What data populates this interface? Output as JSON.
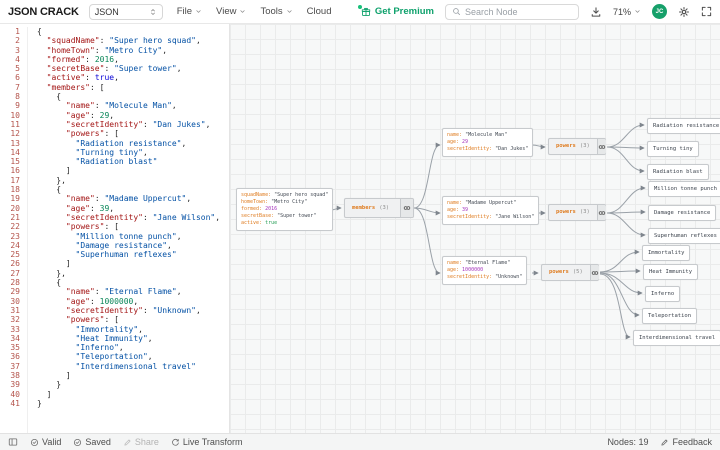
{
  "toolbar": {
    "logo": "JSON CRACK",
    "format_select": "JSON",
    "menu_file": "File",
    "menu_view": "View",
    "menu_tools": "Tools",
    "menu_cloud": "Cloud",
    "get_premium": "Get Premium",
    "search_placeholder": "Search Node",
    "zoom_level": "71%",
    "avatar_initials": "JC"
  },
  "colors": {
    "accent_green": "#0ea16c",
    "node_key_orange": "#df7c20",
    "node_number_purple": "#a534bd",
    "node_bool_green": "#2ba05a",
    "editor_key_red": "#a31515",
    "editor_string_blue": "#0451a5",
    "editor_number_green": "#098658"
  },
  "editor": {
    "lines": [
      [
        [
          "p",
          "{"
        ]
      ],
      [
        [
          "p",
          "  "
        ],
        [
          "k",
          "\"squadName\""
        ],
        [
          "p",
          ": "
        ],
        [
          "s",
          "\"Super hero squad\""
        ],
        [
          "p",
          ","
        ]
      ],
      [
        [
          "p",
          "  "
        ],
        [
          "k",
          "\"homeTown\""
        ],
        [
          "p",
          ": "
        ],
        [
          "s",
          "\"Metro City\""
        ],
        [
          "p",
          ","
        ]
      ],
      [
        [
          "p",
          "  "
        ],
        [
          "k",
          "\"formed\""
        ],
        [
          "p",
          ": "
        ],
        [
          "n",
          "2016"
        ],
        [
          "p",
          ","
        ]
      ],
      [
        [
          "p",
          "  "
        ],
        [
          "k",
          "\"secretBase\""
        ],
        [
          "p",
          ": "
        ],
        [
          "s",
          "\"Super tower\""
        ],
        [
          "p",
          ","
        ]
      ],
      [
        [
          "p",
          "  "
        ],
        [
          "k",
          "\"active\""
        ],
        [
          "p",
          ": "
        ],
        [
          "b",
          "true"
        ],
        [
          "p",
          ","
        ]
      ],
      [
        [
          "p",
          "  "
        ],
        [
          "k",
          "\"members\""
        ],
        [
          "p",
          ": ["
        ]
      ],
      [
        [
          "p",
          "    {"
        ]
      ],
      [
        [
          "p",
          "      "
        ],
        [
          "k",
          "\"name\""
        ],
        [
          "p",
          ": "
        ],
        [
          "s",
          "\"Molecule Man\""
        ],
        [
          "p",
          ","
        ]
      ],
      [
        [
          "p",
          "      "
        ],
        [
          "k",
          "\"age\""
        ],
        [
          "p",
          ": "
        ],
        [
          "n",
          "29"
        ],
        [
          "p",
          ","
        ]
      ],
      [
        [
          "p",
          "      "
        ],
        [
          "k",
          "\"secretIdentity\""
        ],
        [
          "p",
          ": "
        ],
        [
          "s",
          "\"Dan Jukes\""
        ],
        [
          "p",
          ","
        ]
      ],
      [
        [
          "p",
          "      "
        ],
        [
          "k",
          "\"powers\""
        ],
        [
          "p",
          ": ["
        ]
      ],
      [
        [
          "p",
          "        "
        ],
        [
          "s",
          "\"Radiation resistance\""
        ],
        [
          "p",
          ","
        ]
      ],
      [
        [
          "p",
          "        "
        ],
        [
          "s",
          "\"Turning tiny\""
        ],
        [
          "p",
          ","
        ]
      ],
      [
        [
          "p",
          "        "
        ],
        [
          "s",
          "\"Radiation blast\""
        ]
      ],
      [
        [
          "p",
          "      ]"
        ]
      ],
      [
        [
          "p",
          "    },"
        ]
      ],
      [
        [
          "p",
          "    {"
        ]
      ],
      [
        [
          "p",
          "      "
        ],
        [
          "k",
          "\"name\""
        ],
        [
          "p",
          ": "
        ],
        [
          "s",
          "\"Madame Uppercut\""
        ],
        [
          "p",
          ","
        ]
      ],
      [
        [
          "p",
          "      "
        ],
        [
          "k",
          "\"age\""
        ],
        [
          "p",
          ": "
        ],
        [
          "n",
          "39"
        ],
        [
          "p",
          ","
        ]
      ],
      [
        [
          "p",
          "      "
        ],
        [
          "k",
          "\"secretIdentity\""
        ],
        [
          "p",
          ": "
        ],
        [
          "s",
          "\"Jane Wilson\""
        ],
        [
          "p",
          ","
        ]
      ],
      [
        [
          "p",
          "      "
        ],
        [
          "k",
          "\"powers\""
        ],
        [
          "p",
          ": ["
        ]
      ],
      [
        [
          "p",
          "        "
        ],
        [
          "s",
          "\"Million tonne punch\""
        ],
        [
          "p",
          ","
        ]
      ],
      [
        [
          "p",
          "        "
        ],
        [
          "s",
          "\"Damage resistance\""
        ],
        [
          "p",
          ","
        ]
      ],
      [
        [
          "p",
          "        "
        ],
        [
          "s",
          "\"Superhuman reflexes\""
        ]
      ],
      [
        [
          "p",
          "      ]"
        ]
      ],
      [
        [
          "p",
          "    },"
        ]
      ],
      [
        [
          "p",
          "    {"
        ]
      ],
      [
        [
          "p",
          "      "
        ],
        [
          "k",
          "\"name\""
        ],
        [
          "p",
          ": "
        ],
        [
          "s",
          "\"Eternal Flame\""
        ],
        [
          "p",
          ","
        ]
      ],
      [
        [
          "p",
          "      "
        ],
        [
          "k",
          "\"age\""
        ],
        [
          "p",
          ": "
        ],
        [
          "n",
          "1000000"
        ],
        [
          "p",
          ","
        ]
      ],
      [
        [
          "p",
          "      "
        ],
        [
          "k",
          "\"secretIdentity\""
        ],
        [
          "p",
          ": "
        ],
        [
          "s",
          "\"Unknown\""
        ],
        [
          "p",
          ","
        ]
      ],
      [
        [
          "p",
          "      "
        ],
        [
          "k",
          "\"powers\""
        ],
        [
          "p",
          ": ["
        ]
      ],
      [
        [
          "p",
          "        "
        ],
        [
          "s",
          "\"Immortality\""
        ],
        [
          "p",
          ","
        ]
      ],
      [
        [
          "p",
          "        "
        ],
        [
          "s",
          "\"Heat Immunity\""
        ],
        [
          "p",
          ","
        ]
      ],
      [
        [
          "p",
          "        "
        ],
        [
          "s",
          "\"Inferno\""
        ],
        [
          "p",
          ","
        ]
      ],
      [
        [
          "p",
          "        "
        ],
        [
          "s",
          "\"Teleportation\""
        ],
        [
          "p",
          ","
        ]
      ],
      [
        [
          "p",
          "        "
        ],
        [
          "s",
          "\"Interdimensional travel\""
        ]
      ],
      [
        [
          "p",
          "      ]"
        ]
      ],
      [
        [
          "p",
          "    }"
        ]
      ],
      [
        [
          "p",
          "  ]"
        ]
      ],
      [
        [
          "p",
          "}"
        ]
      ]
    ]
  },
  "graph": {
    "root": {
      "rows": [
        {
          "k": "squadName:",
          "v": "\"Super hero squad\"",
          "t": "s"
        },
        {
          "k": "homeTown:",
          "v": "\"Metro City\"",
          "t": "s"
        },
        {
          "k": "formed:",
          "v": "2016",
          "t": "n"
        },
        {
          "k": "secretBase:",
          "v": "\"Super tower\"",
          "t": "s"
        },
        {
          "k": "active:",
          "v": "true",
          "t": "b"
        }
      ]
    },
    "members": {
      "label": "members",
      "count": "(3)"
    },
    "member1": {
      "rows": [
        {
          "k": "name:",
          "v": "\"Molecule Man\"",
          "t": "s"
        },
        {
          "k": "age:",
          "v": "29",
          "t": "n"
        },
        {
          "k": "secretIdentity:",
          "v": "\"Dan Jukes\"",
          "t": "s"
        }
      ]
    },
    "powers1": {
      "label": "powers",
      "count": "(3)"
    },
    "leaves1": [
      "Radiation resistance",
      "Turning tiny",
      "Radiation blast"
    ],
    "member2": {
      "rows": [
        {
          "k": "name:",
          "v": "\"Madame Uppercut\"",
          "t": "s"
        },
        {
          "k": "age:",
          "v": "39",
          "t": "n"
        },
        {
          "k": "secretIdentity:",
          "v": "\"Jane Wilson\"",
          "t": "s"
        }
      ]
    },
    "powers2": {
      "label": "powers",
      "count": "(3)"
    },
    "leaves2": [
      "Million tonne punch",
      "Damage resistance",
      "Superhuman reflexes"
    ],
    "member3": {
      "rows": [
        {
          "k": "name:",
          "v": "\"Eternal Flame\"",
          "t": "s"
        },
        {
          "k": "age:",
          "v": "1000000",
          "t": "n"
        },
        {
          "k": "secretIdentity:",
          "v": "\"Unknown\"",
          "t": "s"
        }
      ]
    },
    "powers3": {
      "label": "powers",
      "count": "(5)"
    },
    "leaves3": [
      "Immortality",
      "Heat Immunity",
      "Inferno",
      "Teleportation",
      "Interdimensional travel"
    ]
  },
  "statusbar": {
    "valid": "Valid",
    "saved": "Saved",
    "share": "Share",
    "live_transform": "Live Transform",
    "nodes_count": "Nodes: 19",
    "feedback": "Feedback"
  }
}
